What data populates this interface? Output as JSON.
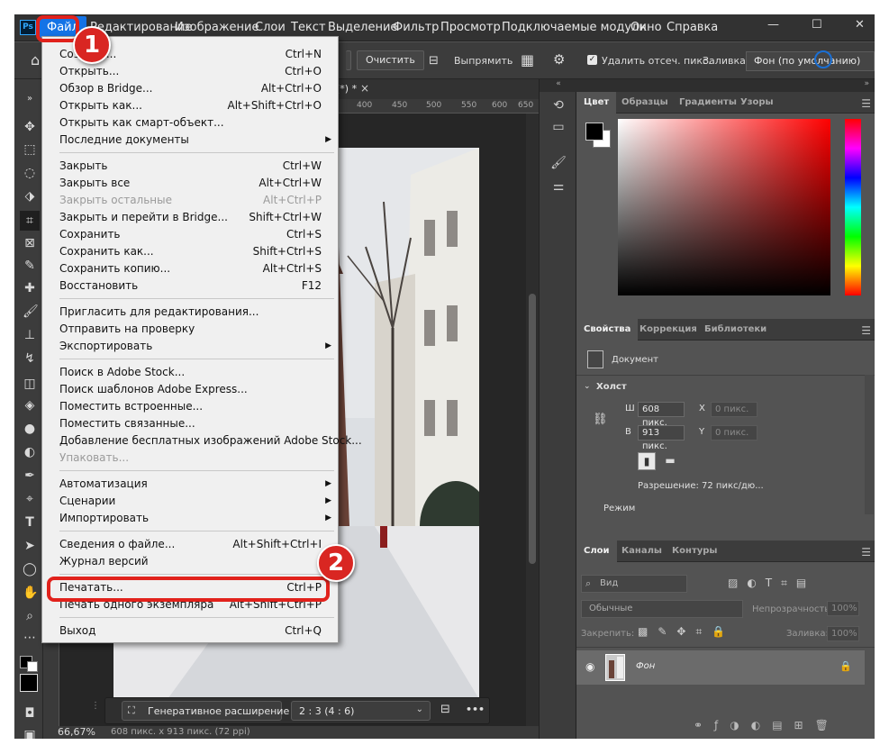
{
  "app": {
    "logo": "Ps",
    "menubar": [
      "Файл",
      "Редактирование",
      "Изображение",
      "Слои",
      "Текст",
      "Выделение",
      "Фильтр",
      "Просмотр",
      "Подключаемые модули",
      "Окно",
      "Справка"
    ],
    "window_controls": {
      "minimize": "—",
      "maximize": "☐",
      "close": "✕"
    }
  },
  "options_bar": {
    "clear_button": "Очистить",
    "straighten_label": "Выпрямить",
    "delete_cropped_label": "Удалить отсеч. пикс.",
    "fill_label": "Заливка:",
    "fill_value": "Фон (по умолчанию)"
  },
  "document": {
    "tab_title": "(*) *",
    "tab_close": "×",
    "ruler_marks": [
      "400",
      "450",
      "500",
      "550",
      "600",
      "650"
    ],
    "zoom": "66,67%",
    "status": "608 пикс. x 913 пикс. (72 ppi)"
  },
  "context_bar": {
    "generative_expand": "Генеративное расширение",
    "ratio_value": "2 : 3 (4 : 6)",
    "more": "•••"
  },
  "file_menu": {
    "items": [
      {
        "label": "Создать...",
        "shortcut": "Ctrl+N"
      },
      {
        "label": "Открыть...",
        "shortcut": "Ctrl+O"
      },
      {
        "label": "Обзор в Bridge...",
        "shortcut": "Alt+Ctrl+O"
      },
      {
        "label": "Открыть как...",
        "shortcut": "Alt+Shift+Ctrl+O"
      },
      {
        "label": "Открыть как смарт-объект...",
        "shortcut": ""
      },
      {
        "label": "Последние документы",
        "shortcut": "",
        "submenu": "▶"
      },
      {
        "label": "Закрыть",
        "shortcut": "Ctrl+W"
      },
      {
        "label": "Закрыть все",
        "shortcut": "Alt+Ctrl+W"
      },
      {
        "label": "Закрыть остальные",
        "shortcut": "Alt+Ctrl+P",
        "disabled": true
      },
      {
        "label": "Закрыть и перейти в Bridge...",
        "shortcut": "Shift+Ctrl+W"
      },
      {
        "label": "Сохранить",
        "shortcut": "Ctrl+S"
      },
      {
        "label": "Сохранить как...",
        "shortcut": "Shift+Ctrl+S"
      },
      {
        "label": "Сохранить копию...",
        "shortcut": "Alt+Ctrl+S"
      },
      {
        "label": "Восстановить",
        "shortcut": "F12"
      },
      {
        "label": "Пригласить для редактирования...",
        "shortcut": ""
      },
      {
        "label": "Отправить на проверку",
        "shortcut": ""
      },
      {
        "label": "Экспортировать",
        "shortcut": "",
        "submenu": "▶"
      },
      {
        "label": "Поиск в Adobe Stock...",
        "shortcut": ""
      },
      {
        "label": "Поиск шаблонов Adobe Express...",
        "shortcut": ""
      },
      {
        "label": "Поместить встроенные...",
        "shortcut": ""
      },
      {
        "label": "Поместить связанные...",
        "shortcut": ""
      },
      {
        "label": "Добавление бесплатных изображений Adobe Stock...",
        "shortcut": ""
      },
      {
        "label": "Упаковать...",
        "shortcut": "",
        "disabled": true
      },
      {
        "label": "Автоматизация",
        "shortcut": "",
        "submenu": "▶"
      },
      {
        "label": "Сценарии",
        "shortcut": "",
        "submenu": "▶"
      },
      {
        "label": "Импортировать",
        "shortcut": "",
        "submenu": "▶"
      },
      {
        "label": "Сведения о файле...",
        "shortcut": "Alt+Shift+Ctrl+I"
      },
      {
        "label": "Журнал версий",
        "shortcut": ""
      },
      {
        "label": "Печатать...",
        "shortcut": "Ctrl+P"
      },
      {
        "label": "Печать одного экземпляра",
        "shortcut": "Alt+Shift+Ctrl+P"
      },
      {
        "label": "Выход",
        "shortcut": "Ctrl+Q"
      }
    ]
  },
  "callouts": {
    "one": "1",
    "two": "2"
  },
  "color_panel": {
    "tabs": [
      "Цвет",
      "Образцы",
      "Градиенты",
      "Узоры"
    ],
    "foreground": "#000000",
    "background": "#ffffff",
    "hue_color": "#ff0000"
  },
  "properties_panel": {
    "tabs": [
      "Свойства",
      "Коррекция",
      "Библиотеки"
    ],
    "type_label": "Документ",
    "section": "Холст",
    "w_label": "Ш",
    "w_value": "608 пикс.",
    "h_label": "В",
    "h_value": "913 пикс.",
    "x_label": "X",
    "x_value": "0 пикс.",
    "y_label": "Y",
    "y_value": "0 пикс.",
    "resolution": "Разрешение: 72 пикс/дю...",
    "mode": "Режим"
  },
  "layers_panel": {
    "tabs": [
      "Слои",
      "Каналы",
      "Контуры"
    ],
    "search_placeholder": "Вид",
    "blend_mode": "Обычные",
    "opacity_label": "Непрозрачность:",
    "opacity_value": "100%",
    "lock_label": "Закрепить:",
    "fill_label": "Заливка:",
    "fill_value": "100%",
    "layers": [
      {
        "name": "Фон"
      }
    ]
  }
}
